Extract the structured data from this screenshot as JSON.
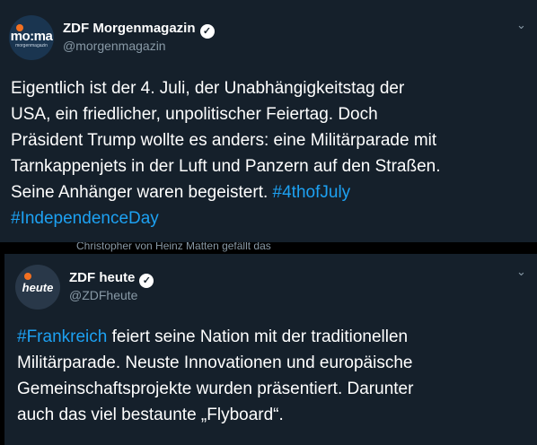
{
  "tweet1": {
    "avatar": {
      "text": "mo:ma",
      "subtext": "morgenmagazin"
    },
    "name": "ZDF Morgenmagazin",
    "handle": "@morgenmagazin",
    "lines": [
      "Eigentlich ist der 4. Juli, der Unabhängigkeitstag der",
      "USA, ein friedlicher, unpolitischer Feiertag. Doch",
      "Präsident Trump wollte es anders: eine Militärparade mit",
      "Tarnkappenjets in der Luft und Panzern auf den Straßen.",
      "Seine Anhänger waren begeistert."
    ],
    "hashtag1": "#4thofJuly",
    "hashtag2": "#IndependenceDay"
  },
  "retweet_note": "Christopher von Heinz Matten gefällt das",
  "tweet2": {
    "avatar": {
      "text": "heute"
    },
    "name": "ZDF heute",
    "handle": "@ZDFheute",
    "hashtag": "#Frankreich",
    "lines": [
      " feiert seine Nation mit der traditionellen",
      "Militärparade. Neuste Innovationen und europäische",
      "Gemeinschaftsprojekte wurden präsentiert. Darunter",
      "auch das viel bestaunte „Flyboard“."
    ]
  },
  "icons": {
    "verified": "✓",
    "chevron": "⌄"
  },
  "colors": {
    "background": "#15202b",
    "hashtag": "#1da1f2",
    "muted": "#8899a6"
  }
}
